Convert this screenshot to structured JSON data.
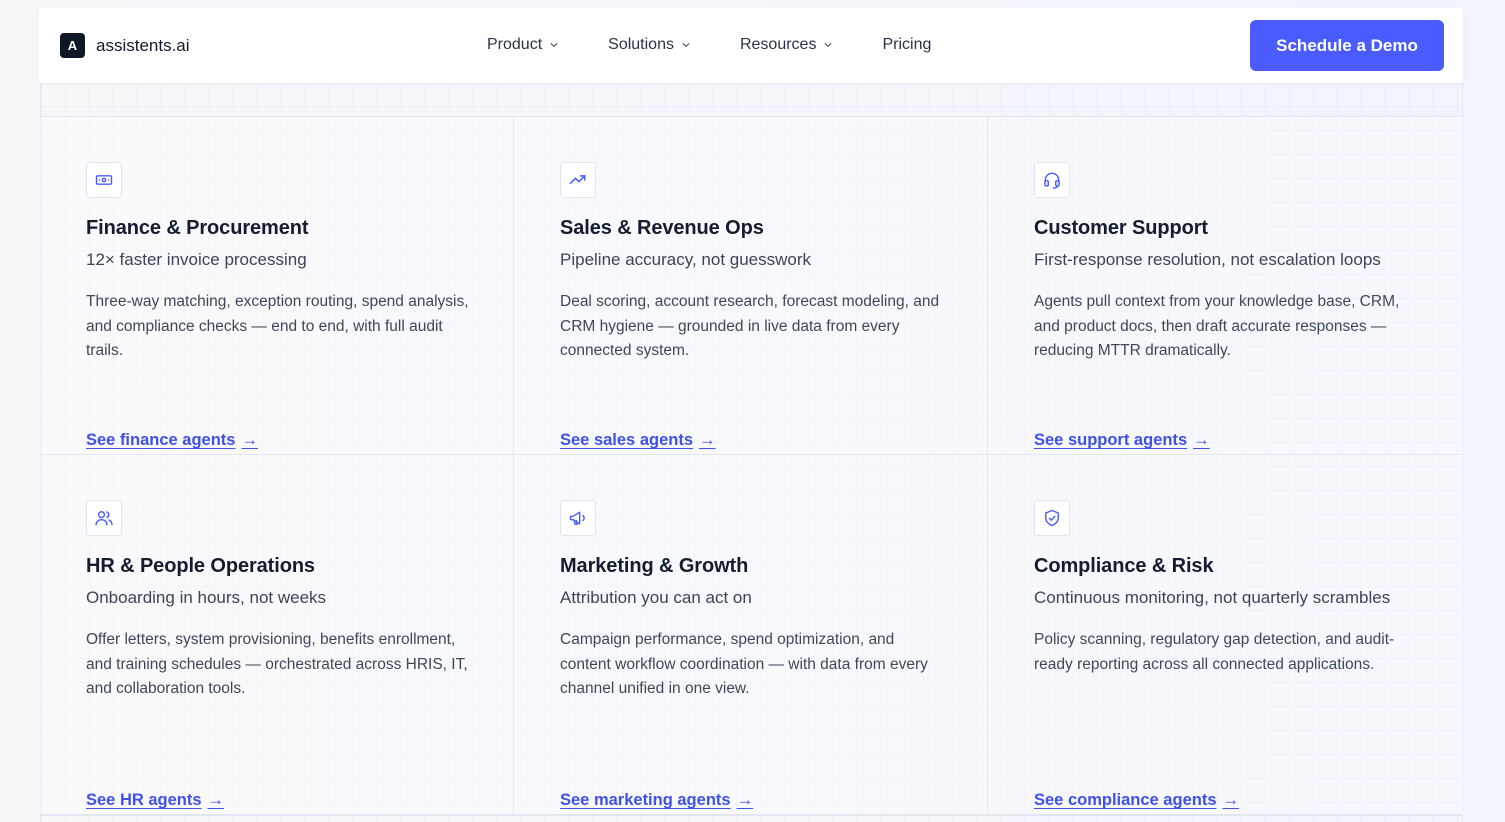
{
  "brand": {
    "logo_letter": "A",
    "name": "assistents.ai"
  },
  "nav": {
    "items": [
      {
        "label": "Product",
        "has_dropdown": true
      },
      {
        "label": "Solutions",
        "has_dropdown": true
      },
      {
        "label": "Resources",
        "has_dropdown": true
      },
      {
        "label": "Pricing",
        "has_dropdown": false
      }
    ],
    "cta_label": "Schedule a Demo"
  },
  "colors": {
    "accent": "#4a5cff",
    "link": "#3f51e6",
    "heading": "#141c30"
  },
  "cards": [
    {
      "icon": "banknote-icon",
      "title": "Finance & Procurement",
      "subtitle": "12× faster invoice processing",
      "description": "Three-way matching, exception routing, spend analysis, and compliance checks — end to end, with full audit trails.",
      "link": "See finance agents"
    },
    {
      "icon": "trending-up-icon",
      "title": "Sales & Revenue Ops",
      "subtitle": "Pipeline accuracy, not guesswork",
      "description": "Deal scoring, account research, forecast modeling, and CRM hygiene — grounded in live data from every connected system.",
      "link": "See sales agents"
    },
    {
      "icon": "headset-icon",
      "title": "Customer Support",
      "subtitle": "First-response resolution, not escalation loops",
      "description": "Agents pull context from your knowledge base, CRM, and product docs, then draft accurate responses — reducing MTTR dramatically.",
      "link": "See support agents"
    },
    {
      "icon": "users-icon",
      "title": "HR & People Operations",
      "subtitle": "Onboarding in hours, not weeks",
      "description": "Offer letters, system provisioning, benefits enrollment, and training schedules — orchestrated across HRIS, IT, and collaboration tools.",
      "link": "See HR agents"
    },
    {
      "icon": "megaphone-icon",
      "title": "Marketing & Growth",
      "subtitle": "Attribution you can act on",
      "description": "Campaign performance, spend optimization, and content workflow coordination — with data from every channel unified in one view.",
      "link": "See marketing agents"
    },
    {
      "icon": "shield-check-icon",
      "title": "Compliance & Risk",
      "subtitle": "Continuous monitoring, not quarterly scrambles",
      "description": "Policy scanning, regulatory gap detection, and audit-ready reporting across all connected applications.",
      "link": "See compliance agents"
    }
  ],
  "link_arrow": "→"
}
